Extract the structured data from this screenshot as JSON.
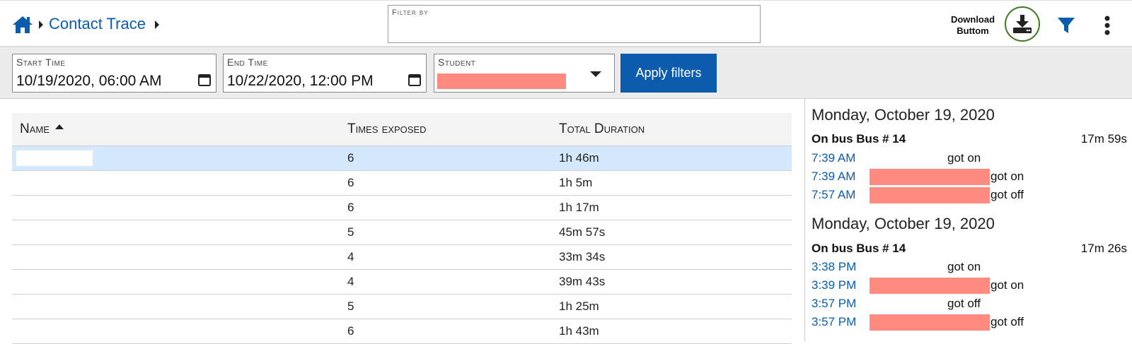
{
  "breadcrumb": {
    "title": "Contact Trace"
  },
  "filter_by": {
    "label": "Filter by",
    "value": ""
  },
  "download": {
    "label": "Download Buttom"
  },
  "filters": {
    "start_time": {
      "label": "Start Time",
      "value": "10/19/2020, 06:00 AM"
    },
    "end_time": {
      "label": "End Time",
      "value": "10/22/2020, 12:00 PM"
    },
    "student": {
      "label": "Student"
    },
    "apply_label": "Apply filters"
  },
  "table": {
    "headers": {
      "name": "Name",
      "times_exposed": "Times exposed",
      "total_duration": "Total Duration"
    },
    "rows": [
      {
        "times": "6",
        "duration": "1h 46m"
      },
      {
        "times": "6",
        "duration": "1h 5m"
      },
      {
        "times": "6",
        "duration": "1h 17m"
      },
      {
        "times": "5",
        "duration": "45m 57s"
      },
      {
        "times": "4",
        "duration": "33m 34s"
      },
      {
        "times": "4",
        "duration": "39m 43s"
      },
      {
        "times": "5",
        "duration": "1h 25m"
      },
      {
        "times": "6",
        "duration": "1h 43m"
      }
    ]
  },
  "details": {
    "days": [
      {
        "date": "Monday, October 19, 2020",
        "bus": "On bus Bus # 14",
        "duration": "17m 59s",
        "events": [
          {
            "time": "7:39 AM",
            "action": "got on"
          },
          {
            "time": "7:39 AM",
            "action": "got on"
          },
          {
            "time": "7:57 AM",
            "action": "got off"
          }
        ]
      },
      {
        "date": "Monday, October 19, 2020",
        "bus": "On bus Bus # 14",
        "duration": "17m 26s",
        "events": [
          {
            "time": "3:38 PM",
            "action": "got on"
          },
          {
            "time": "3:39 PM",
            "action": "got on"
          },
          {
            "time": "3:57 PM",
            "action": "got off"
          },
          {
            "time": "3:57 PM",
            "action": "got off"
          }
        ]
      }
    ]
  },
  "colors": {
    "accent": "#0b5cad",
    "redaction": "#ff8b80",
    "selected_row": "#d4eafc",
    "download_ring": "#3b7a1e"
  }
}
